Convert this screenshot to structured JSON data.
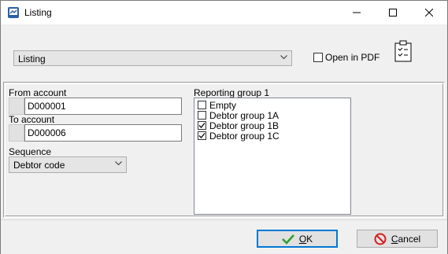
{
  "window": {
    "title": "Listing",
    "minimize_icon": "minimize-icon",
    "maximize_icon": "maximize-icon",
    "close_icon": "close-icon"
  },
  "top": {
    "report_select": {
      "value": "Listing"
    },
    "open_in_pdf": {
      "label": "Open in PDF",
      "checked": false
    },
    "clipboard_icon": "clipboard-check-icon"
  },
  "form": {
    "from_account": {
      "label": "From account",
      "value": "D000001"
    },
    "to_account": {
      "label": "To account",
      "value": "D000006"
    },
    "sequence": {
      "label": "Sequence",
      "value": "Debtor code"
    },
    "reporting_group": {
      "label": "Reporting group 1",
      "items": [
        {
          "label": "Empty",
          "checked": false
        },
        {
          "label": "Debtor group 1A",
          "checked": false
        },
        {
          "label": "Debtor group 1B",
          "checked": true
        },
        {
          "label": "Debtor group 1C",
          "checked": true
        }
      ]
    }
  },
  "buttons": {
    "ok": "OK",
    "cancel": "Cancel"
  }
}
